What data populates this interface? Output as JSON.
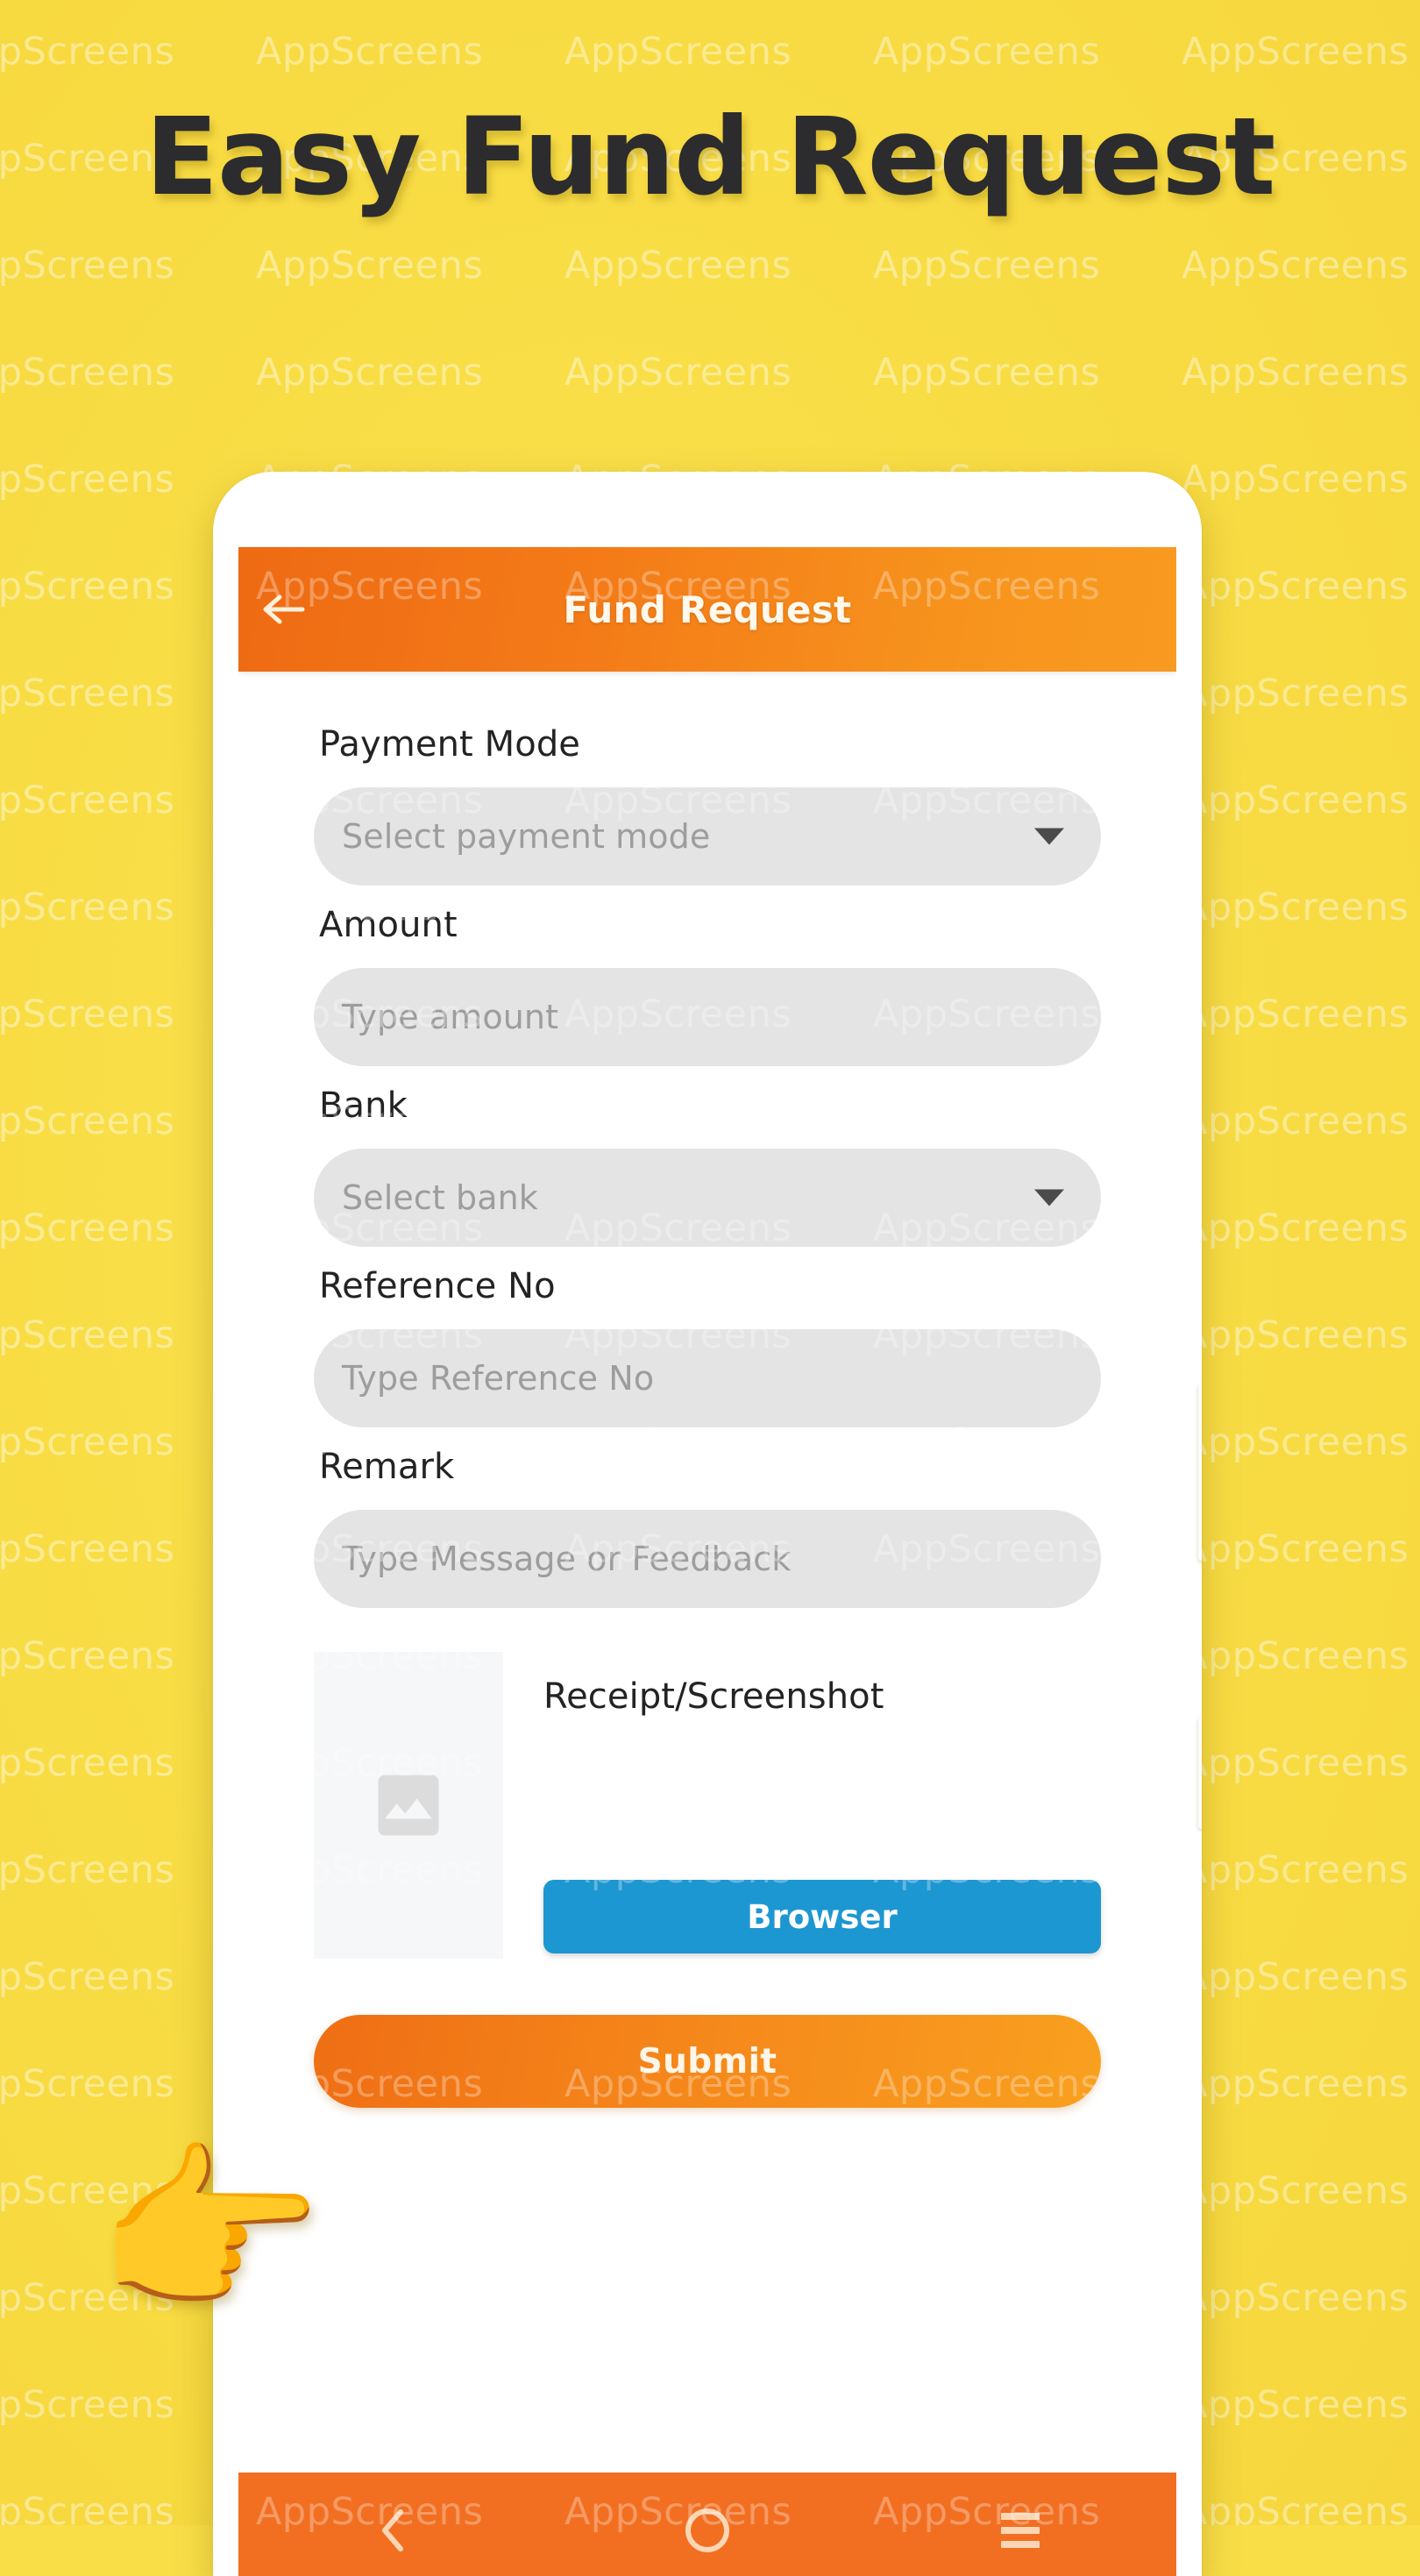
{
  "promo": {
    "headline": "Easy Fund Request",
    "background_color": "#F9DD45",
    "watermark_text": "AppScreens",
    "pointing_hand_icon": "pointing-right-hand-emoji",
    "hand_glyph": "👉"
  },
  "app": {
    "app_bar": {
      "title": "Fund Request",
      "back_icon": "back-arrow-icon",
      "gradient_start": "#EE6A13",
      "gradient_end": "#F99A20"
    },
    "form": {
      "fields": [
        {
          "label": "Payment Mode",
          "placeholder": "Select payment mode",
          "value": "",
          "type": "dropdown",
          "icon": "chevron-down-icon"
        },
        {
          "label": "Amount",
          "placeholder": "Type amount",
          "value": "",
          "type": "text"
        },
        {
          "label": "Bank",
          "placeholder": "Select bank",
          "value": "",
          "type": "dropdown",
          "icon": "chevron-down-icon"
        },
        {
          "label": "Reference No",
          "placeholder": "Type Reference No",
          "value": "",
          "type": "text"
        },
        {
          "label": "Remark",
          "placeholder": "Type Message or Feedback",
          "value": "",
          "type": "text"
        }
      ],
      "receipt": {
        "label": "Receipt/Screenshot",
        "thumb_icon": "image-placeholder-icon",
        "browse_button_label": "Browser",
        "browse_button_color": "#1D97D1"
      },
      "submit_button_label": "Submit"
    },
    "nav_bar": {
      "background_color": "#F26F21",
      "back_icon": "chevron-left-icon",
      "home_icon": "circle-home-icon",
      "recents_icon": "hamburger-menu-icon"
    }
  }
}
